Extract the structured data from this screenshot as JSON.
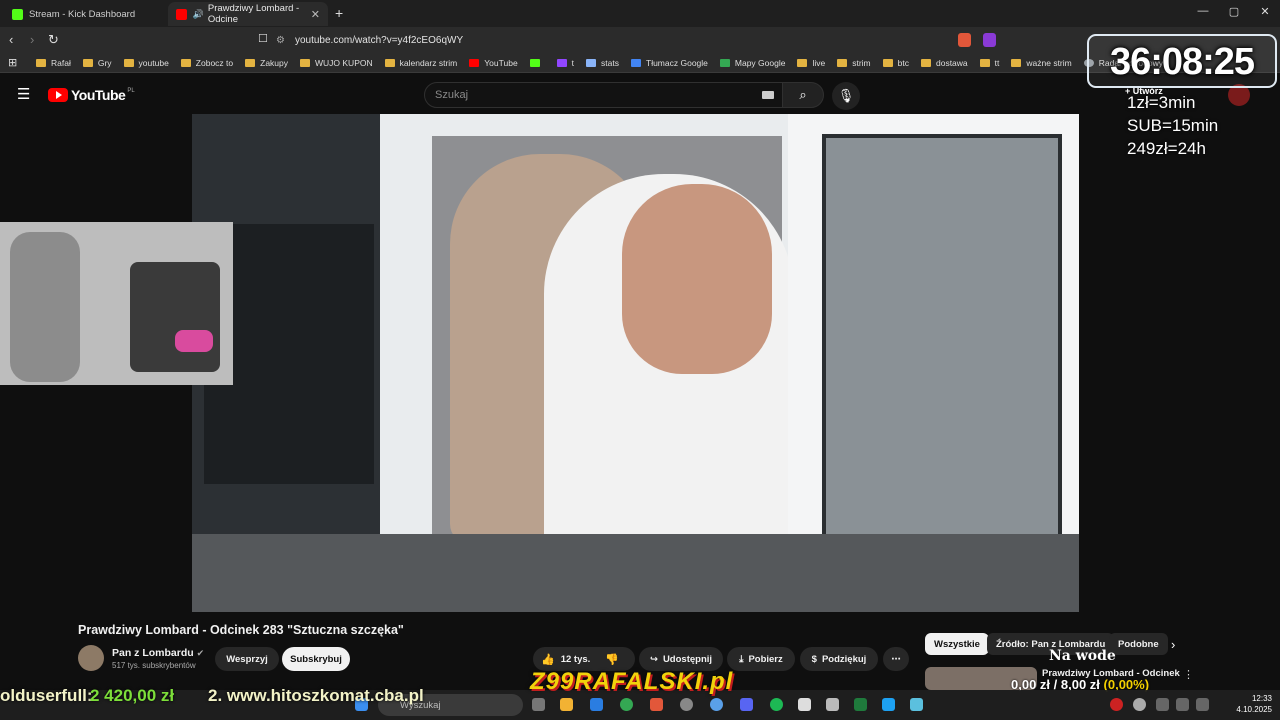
{
  "browser": {
    "tabs": [
      {
        "title": "Stream - Kick Dashboard",
        "favicon_color": "#53fc18"
      },
      {
        "title": "Prawdziwy Lombard - Odcine",
        "favicon_color": "#ff0000"
      }
    ],
    "new_tab": "+",
    "address": "youtube.com/watch?v=y4f2cEO6qWY",
    "bookmarks": [
      "Rafał",
      "Gry",
      "youtube",
      "Zobocz to",
      "Zakupy",
      "WUJO KUPON",
      "kalendarz strim",
      "YouTube",
      "t",
      "stats",
      "Tłumacz Google",
      "Mapy Google",
      "live",
      "strim",
      "btc",
      "dostawa",
      "tt",
      "ważne strim",
      "Radar pogodowy"
    ],
    "controls": {
      "minimize": "—",
      "maximize": "▢",
      "close": "✕"
    }
  },
  "youtube": {
    "logo": "YouTube",
    "logo_region": "PL",
    "search_placeholder": "Szukaj",
    "create_label": "Utwórz",
    "video_title": "Prawdziwy Lombard - Odcinek 283 \"Sztuczna szczęka\"",
    "channel": {
      "name": "Pan z Lombardu",
      "subscribers": "517 tys. subskrybentów"
    },
    "buttons": {
      "support": "Wesprzyj",
      "subscribe": "Subskrybuj",
      "likes": "12 tys.",
      "share": "Udostępnij",
      "download": "Pobierz",
      "thanks": "Podziękuj",
      "more": "⋯"
    },
    "chips": [
      "Wszystkie",
      "Źródło: Pan z Lombardu",
      "Podobne"
    ],
    "related": {
      "title": "Prawdziwy Lombard - Odcinek"
    }
  },
  "overlay": {
    "timer": "36:08:25",
    "rules": [
      "1zł=3min",
      "SUB=15min",
      "249zł=24h"
    ],
    "ticker_user": "olduserfull:",
    "ticker_amount": "2 420,00 zł",
    "ticker_site": "2. www.hitoszkomat.cba.pl",
    "banner": "Z99RAFALSKI.pl",
    "na_wode": "Na wode",
    "donate_text": "0,00 zł",
    "donate_goal": " / 8,00 zł",
    "donate_pct": " (0,00%)"
  },
  "taskbar": {
    "search_placeholder": "Wyszukaj",
    "time": "12:33",
    "date": "4.10.2025"
  }
}
